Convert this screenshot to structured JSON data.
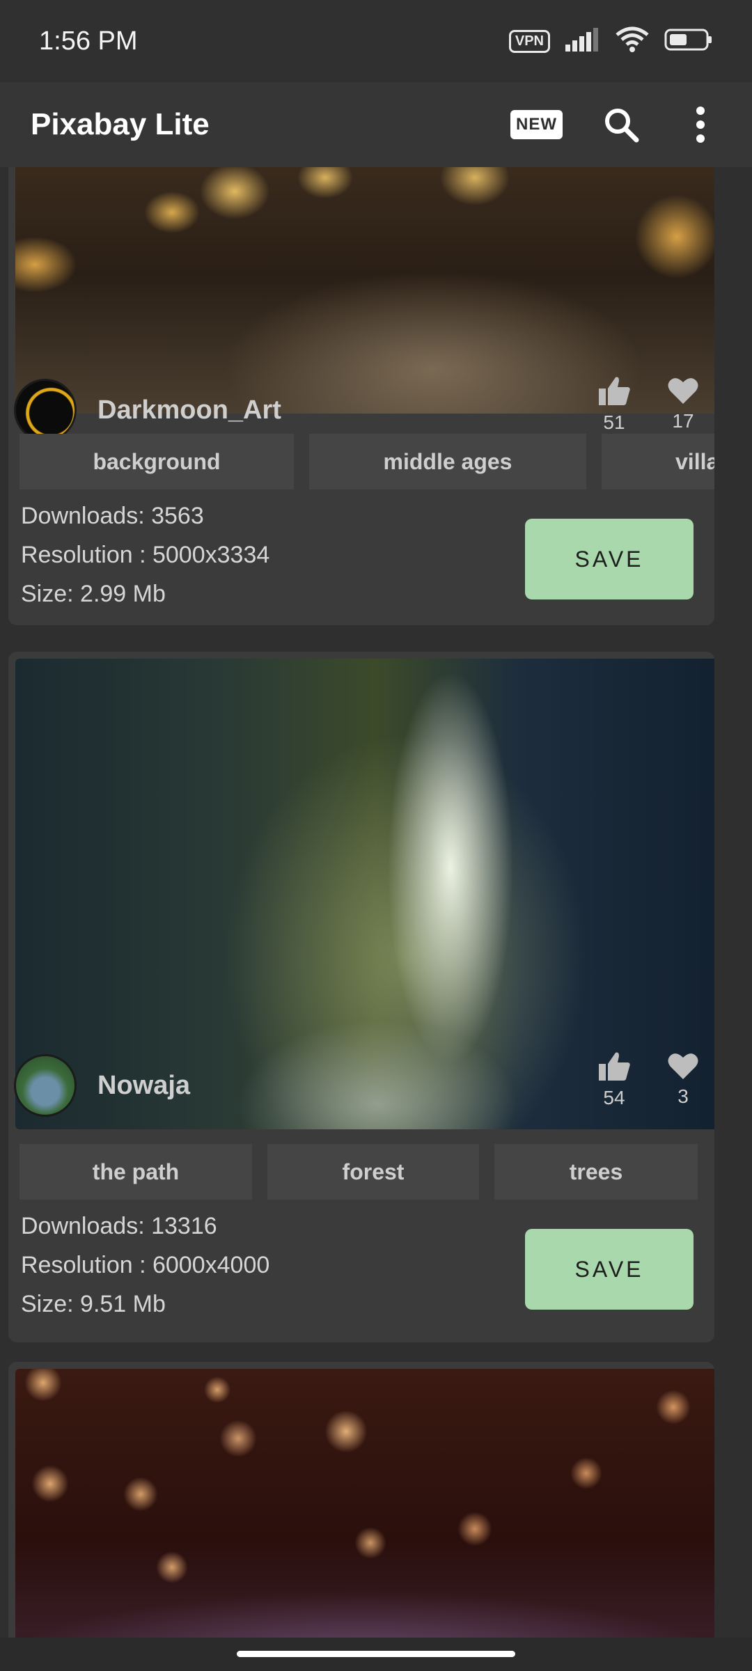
{
  "status_bar": {
    "time": "1:56 PM",
    "vpn_label": "VPN"
  },
  "app_bar": {
    "title": "Pixabay Lite",
    "new_badge": "NEW",
    "icons": [
      "new-icon",
      "search-icon",
      "more-vert-icon"
    ]
  },
  "cards": [
    {
      "owner": "Darkmoon_Art",
      "likes": "51",
      "favorites": "17",
      "tags": [
        "background",
        "middle ages",
        "village"
      ],
      "downloads": "Downloads: 3563",
      "resolution": "Resolution : 5000x3334",
      "size": "Size: 2.99 Mb",
      "save_label": "SAVE"
    },
    {
      "owner": "Nowaja",
      "likes": "54",
      "favorites": "3",
      "tags": [
        "the path",
        "forest",
        "trees"
      ],
      "downloads": "Downloads: 13316",
      "resolution": "Resolution : 6000x4000",
      "size": "Size: 9.51 Mb",
      "save_label": "SAVE"
    }
  ],
  "colors": {
    "background": "#2f2f2f",
    "card": "#3b3b3b",
    "tag": "#454545",
    "save_button": "#a8d8ab"
  }
}
